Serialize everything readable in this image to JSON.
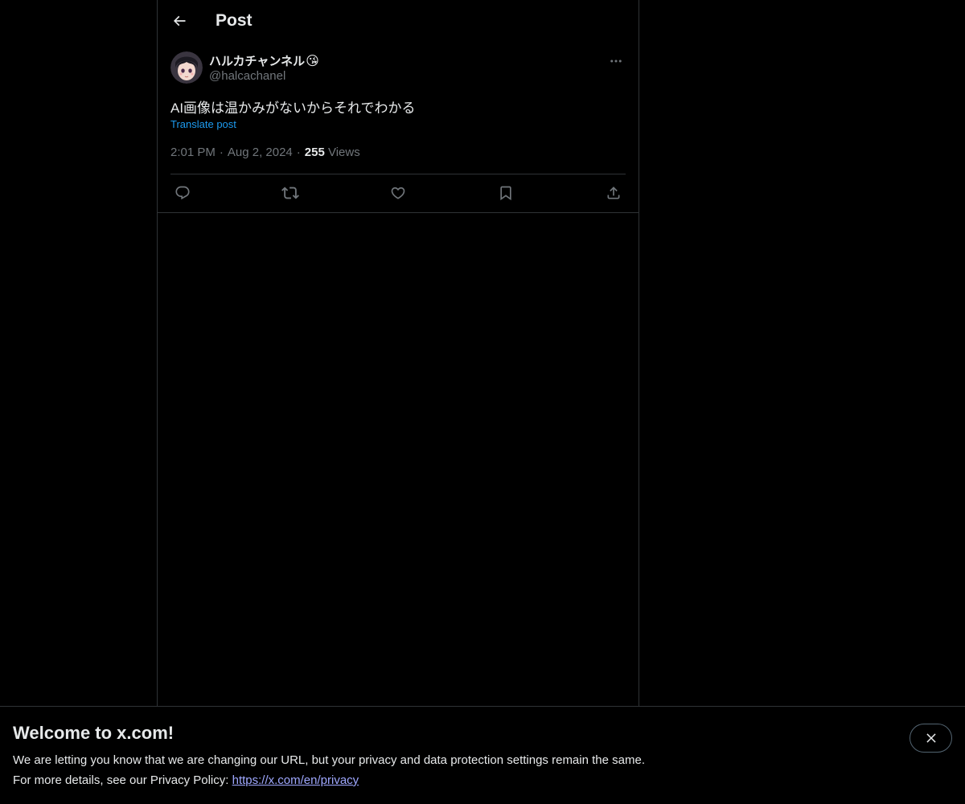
{
  "header": {
    "title": "Post",
    "back_icon": "back-arrow-icon"
  },
  "post": {
    "author": {
      "display_name": "ハルカチャンネル",
      "emoji": "😘",
      "handle": "@halcachanel"
    },
    "text": "AI画像は温かみがないからそれでわかる",
    "translate_label": "Translate post",
    "time": "2:01 PM",
    "date": "Aug 2, 2024",
    "views_count": "255",
    "views_label": "Views",
    "separator": "·",
    "actions": [
      {
        "name": "reply",
        "icon": "reply-icon"
      },
      {
        "name": "repost",
        "icon": "repost-icon"
      },
      {
        "name": "like",
        "icon": "like-icon"
      },
      {
        "name": "bookmark",
        "icon": "bookmark-icon"
      },
      {
        "name": "share",
        "icon": "share-icon"
      }
    ]
  },
  "banner": {
    "title": "Welcome to x.com!",
    "line1": "We are letting you know that we are changing our URL, but your privacy and data protection settings remain the same.",
    "line2_prefix": "For more details, see our Privacy Policy:",
    "link_text": "https://x.com/en/privacy"
  },
  "colors": {
    "background": "#000000",
    "text_primary": "#e7e9ea",
    "text_secondary": "#71767b",
    "accent": "#1d9bf0",
    "border": "#2f3336"
  }
}
